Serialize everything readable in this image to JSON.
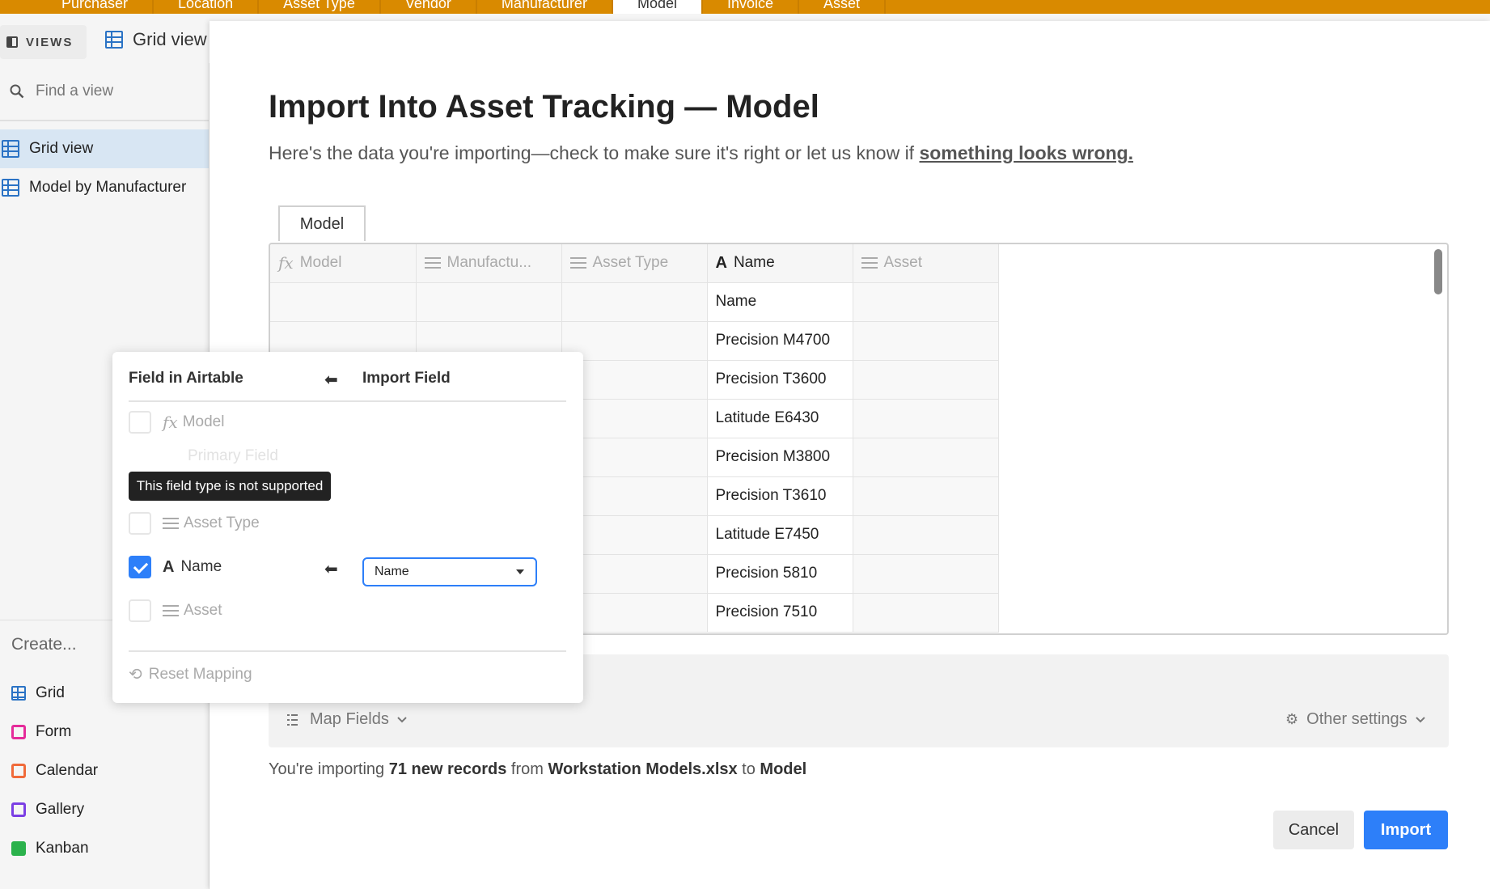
{
  "tabs": [
    {
      "label": "Purchaser"
    },
    {
      "label": "Location"
    },
    {
      "label": "Asset Type"
    },
    {
      "label": "Vendor"
    },
    {
      "label": "Manufacturer"
    },
    {
      "label": "Model",
      "active": true
    },
    {
      "label": "Invoice"
    },
    {
      "label": "Asset"
    }
  ],
  "views_header": {
    "toggle_label": "VIEWS",
    "current_view": "Grid view"
  },
  "sidebar": {
    "find_placeholder": "Find a view",
    "views": [
      {
        "label": "Grid view",
        "selected": true
      },
      {
        "label": "Model by Manufacturer"
      }
    ],
    "create_label": "Create...",
    "create_items": [
      {
        "label": "Grid",
        "color": "#2b73c5"
      },
      {
        "label": "Form",
        "color": "#e52b9a"
      },
      {
        "label": "Calendar",
        "color": "#f06a3a"
      },
      {
        "label": "Gallery",
        "color": "#7b3fe4"
      },
      {
        "label": "Kanban",
        "color": "#2bb24c"
      }
    ]
  },
  "dialog": {
    "title": "Import Into Asset Tracking — Model",
    "subtitle": "Here's the data you're importing—check to make sure it's right or let us know if ",
    "subtitle_link": "something looks wrong.",
    "sheet_tab": "Model",
    "columns": [
      {
        "label": "Model",
        "icon": "formula-icon"
      },
      {
        "label": "Manufactu...",
        "icon": "lines-icon"
      },
      {
        "label": "Asset Type",
        "icon": "lines-icon"
      },
      {
        "label": "Name",
        "icon": "text-icon",
        "active": true
      },
      {
        "label": "Asset",
        "icon": "lines-icon"
      }
    ],
    "rows": [
      "Name",
      "Precision M4700",
      "Precision T3600",
      "Latitude E6430",
      "Precision M3800",
      "Precision T3610",
      "Latitude E7450",
      "Precision 5810",
      "Precision 7510"
    ],
    "map_fields_label": "Map Fields",
    "other_settings_label": "Other settings",
    "summary": {
      "prefix": "You're importing ",
      "count": "71 new records",
      "from": " from ",
      "file": "Workstation Models.xlsx",
      "to": " to ",
      "table": "Model"
    },
    "cancel_label": "Cancel",
    "import_label": "Import"
  },
  "mapping": {
    "header_airtable": "Field in Airtable",
    "header_import": "Import Field",
    "model_field": "Model",
    "primary_field_label": "Primary Field",
    "tooltip": "This field type is not supported",
    "asset_type_field": "Asset Type",
    "name_field": "Name",
    "name_select_value": "Name",
    "asset_field": "Asset",
    "reset_label": "Reset Mapping"
  }
}
